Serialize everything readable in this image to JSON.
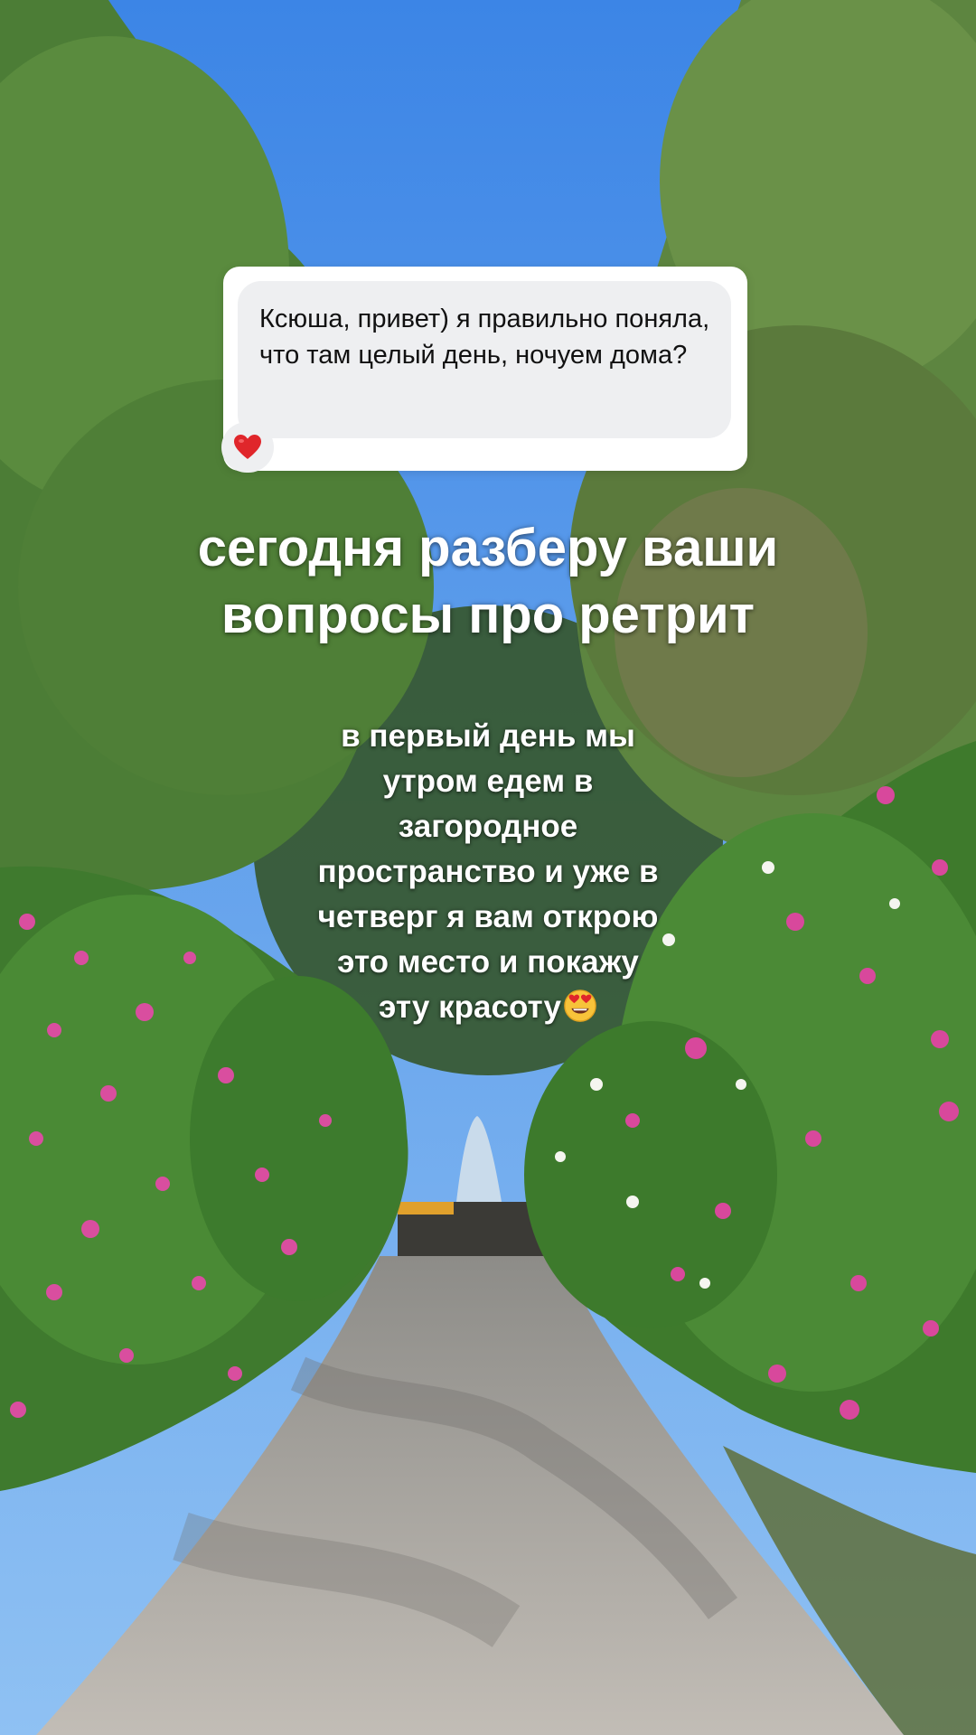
{
  "question": {
    "text": "Ксюша, привет) я правильно поняла, что там целый день, ночуем дома?",
    "reaction_icon": "heart-icon"
  },
  "headline": {
    "line1": "сегодня разберу ваши",
    "line2": "вопросы про ретрит"
  },
  "answer": {
    "line1": "в первый день мы",
    "line2": "утром едем в",
    "line3": "загородное",
    "line4": "пространство и уже в",
    "line5": "четверг я вам открою",
    "line6": "это место и покажу",
    "line7": "эту красоту",
    "emoji_icon": "heart-eyes-emoji-icon"
  },
  "colors": {
    "sky": "#3f86e6",
    "foliage": "#4d7a3b",
    "flowers": "#d64f9e",
    "path": "#b7b3ad",
    "bubble": "#ffffff",
    "bubble_inner": "#eeeff1"
  }
}
